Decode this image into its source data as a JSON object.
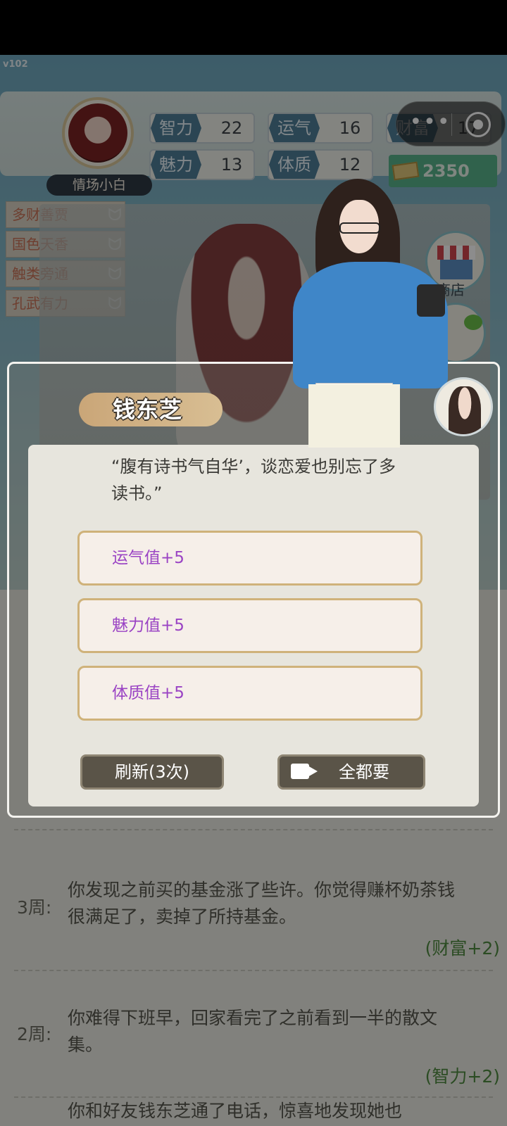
{
  "app": {
    "version": "v102"
  },
  "player": {
    "name": "情场小白",
    "stats": {
      "intelligence": {
        "label": "智力",
        "value": "22"
      },
      "luck": {
        "label": "运气",
        "value": "16"
      },
      "wealth": {
        "label": "财富",
        "value": "17"
      },
      "charm": {
        "label": "魅力",
        "value": "13"
      },
      "physique": {
        "label": "体质",
        "value": "12"
      }
    },
    "money": "2350",
    "traits": [
      "多财善贾",
      "国色天香",
      "触类旁通",
      "孔武有力"
    ]
  },
  "side_menu": {
    "shop_label": "商店"
  },
  "dialog": {
    "speaker": "钱东芝",
    "quote": "“腹有诗书气自华’，谈恋爱也别忘了多读书。”",
    "options": [
      "运气值+5",
      "魅力值+5",
      "体质值+5"
    ],
    "refresh_label": "刷新(3次)",
    "take_all_label": "全都要"
  },
  "log": [
    {
      "week": "3周:",
      "text": "你发现之前买的基金涨了些许。你觉得赚杯奶茶钱很满足了，卖掉了所持基金。",
      "effect": "(财富+2)"
    },
    {
      "week": "2周:",
      "text": "你难得下班早，回家看完了之前看到一半的散文集。",
      "effect": "(智力+2)"
    },
    {
      "week": "",
      "text": "你和好友钱东芝通了电话，惊喜地发现她也",
      "effect": ""
    }
  ],
  "colors": {
    "option_text": "#9a43c4",
    "option_border": "#cfb27a",
    "effect_text": "#4f8a41",
    "money_bg": "#58b28b"
  }
}
